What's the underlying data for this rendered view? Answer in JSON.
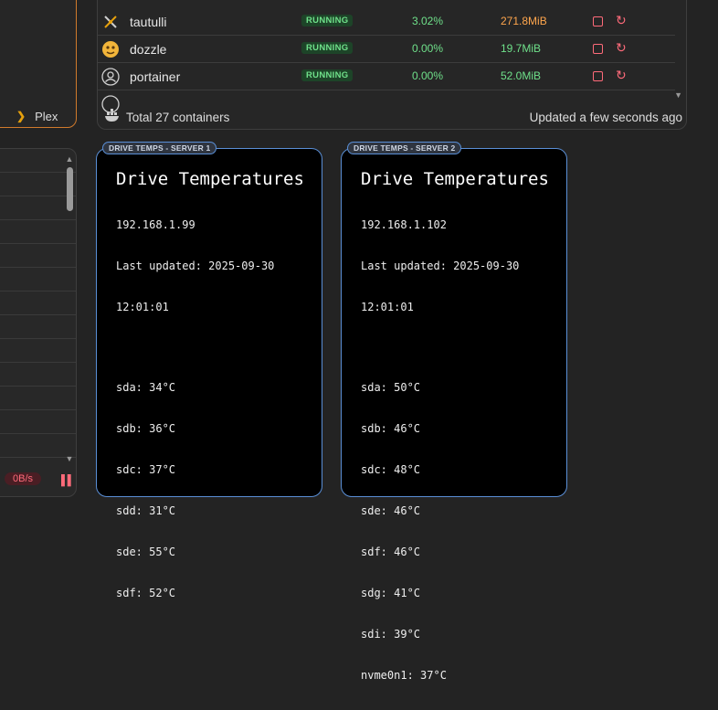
{
  "plex": {
    "link_label": "Plex"
  },
  "network": {
    "rate": "0B/s"
  },
  "docker": {
    "containers": [
      {
        "name": "tautulli",
        "status": "RUNNING",
        "cpu": "3.02%",
        "memory": "271.8MiB",
        "memory_warn": true,
        "icon": "tautulli-icon"
      },
      {
        "name": "dozzle",
        "status": "RUNNING",
        "cpu": "0.00%",
        "memory": "19.7MiB",
        "memory_warn": false,
        "icon": "dozzle-icon"
      },
      {
        "name": "portainer",
        "status": "RUNNING",
        "cpu": "0.00%",
        "memory": "52.0MiB",
        "memory_warn": false,
        "icon": "portainer-icon"
      }
    ],
    "footer": {
      "total": "Total 27 containers",
      "updated": "Updated a few seconds ago"
    }
  },
  "drive_temps": [
    {
      "tag": "DRIVE TEMPS - SERVER 1",
      "title": "Drive Temperatures",
      "host": "192.168.1.99",
      "updated_line1": "Last updated: 2025-09-30",
      "updated_line2": "12:01:01",
      "drives": [
        "sda: 34°C",
        "sdb: 36°C",
        "sdc: 37°C",
        "sdd: 31°C",
        "sde: 55°C",
        "sdf: 52°C"
      ]
    },
    {
      "tag": "DRIVE TEMPS - SERVER 2",
      "title": "Drive Temperatures",
      "host": "192.168.1.102",
      "updated_line1": "Last updated: 2025-09-30",
      "updated_line2": "12:01:01",
      "drives": [
        "sda: 50°C",
        "sdb: 46°C",
        "sdc: 48°C",
        "sde: 46°C",
        "sdf: 46°C",
        "sdg: 41°C",
        "sdi: 39°C",
        "nvme0n1: 37°C"
      ]
    }
  ],
  "colors": {
    "accent_orange": "#d07a2c",
    "card_border": "#5a8fd6",
    "running_green": "#6fe08a",
    "danger_red": "#ff6b7a"
  }
}
